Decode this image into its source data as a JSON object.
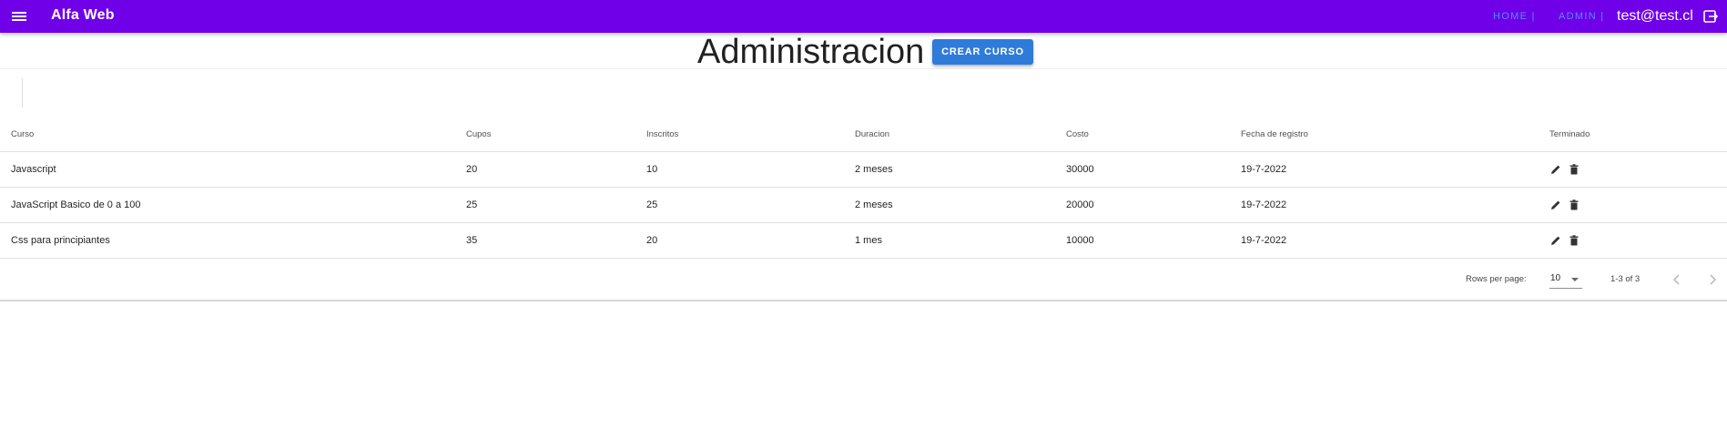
{
  "appbar": {
    "brand": "Alfa Web",
    "nav": [
      {
        "label": "HOME |"
      },
      {
        "label": "ADMIN |"
      }
    ],
    "user_email": "test@test.cl",
    "icons": {
      "menu": "menu-icon",
      "logout": "logout-icon"
    }
  },
  "header": {
    "title": "Administracion",
    "create_button": "CREAR CURSO"
  },
  "table": {
    "columns": [
      "Curso",
      "Cupos",
      "Inscritos",
      "Duracion",
      "Costo",
      "Fecha de registro",
      "Terminado"
    ],
    "rows": [
      {
        "curso": "Javascript",
        "cupos": "20",
        "inscritos": "10",
        "duracion": "2 meses",
        "costo": "30000",
        "fecha": "19-7-2022"
      },
      {
        "curso": "JavaScript Basico de 0 a 100",
        "cupos": "25",
        "inscritos": "25",
        "duracion": "2 meses",
        "costo": "20000",
        "fecha": "19-7-2022"
      },
      {
        "curso": "Css para principiantes",
        "cupos": "35",
        "inscritos": "20",
        "duracion": "1 mes",
        "costo": "10000",
        "fecha": "19-7-2022"
      }
    ],
    "row_actions": [
      "pencil-icon",
      "trash-icon"
    ]
  },
  "footer": {
    "rows_per_page_label": "Rows per page:",
    "rows_per_page_value": "10",
    "range_text": "1-3 of 3"
  },
  "colors": {
    "appbar": "#6f00e8",
    "accent_button": "#2f7bd9",
    "nav_link": "#5b86ff"
  }
}
